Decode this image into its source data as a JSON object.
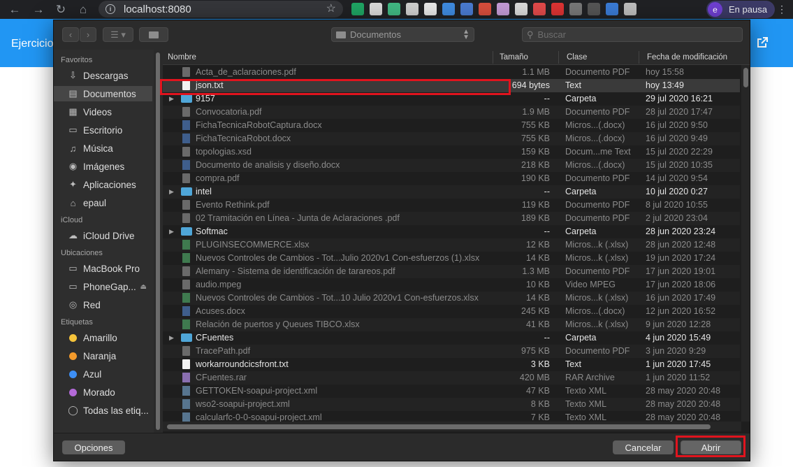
{
  "browser": {
    "url": "localhost:8080",
    "profile_label": "En pausa",
    "profile_initial": "e",
    "extensions": [
      "google-drive-icon",
      "qr-icon",
      "vue-icon",
      "video-icon",
      "download-icon",
      "feather-icon",
      "translate-icon",
      "person-icon",
      "chart-icon",
      "compass-icon",
      "pin-icon",
      "refresh-icon",
      "image-icon",
      "save-icon",
      "shield-icon",
      "puzzle-icon"
    ]
  },
  "page": {
    "title": "Ejercicio"
  },
  "dialog": {
    "location": "Documentos",
    "search_placeholder": "Buscar",
    "sidebar": {
      "sections": [
        {
          "heading": "Favoritos",
          "items": [
            {
              "label": "Descargas",
              "icon": "download-icon"
            },
            {
              "label": "Documentos",
              "icon": "document-icon",
              "selected": true
            },
            {
              "label": "Videos",
              "icon": "film-icon"
            },
            {
              "label": "Escritorio",
              "icon": "desktop-icon"
            },
            {
              "label": "Música",
              "icon": "music-icon"
            },
            {
              "label": "Imágenes",
              "icon": "camera-icon"
            },
            {
              "label": "Aplicaciones",
              "icon": "apps-icon"
            },
            {
              "label": "epaul",
              "icon": "home-icon"
            }
          ]
        },
        {
          "heading": "iCloud",
          "items": [
            {
              "label": "iCloud Drive",
              "icon": "cloud-icon"
            }
          ]
        },
        {
          "heading": "Ubicaciones",
          "items": [
            {
              "label": "MacBook Pro",
              "icon": "laptop-icon"
            },
            {
              "label": "PhoneGap...",
              "icon": "drive-icon"
            },
            {
              "label": "Red",
              "icon": "network-icon"
            }
          ]
        },
        {
          "heading": "Etiquetas",
          "items": [
            {
              "label": "Amarillo",
              "color": "#f5c33b"
            },
            {
              "label": "Naranja",
              "color": "#f39a2b"
            },
            {
              "label": "Azul",
              "color": "#3d8ff5"
            },
            {
              "label": "Morado",
              "color": "#b46ad8"
            },
            {
              "label": "Todas las etiq...",
              "icon": "all-tags-icon"
            }
          ]
        }
      ]
    },
    "columns": {
      "name": "Nombre",
      "size": "Tamaño",
      "kind": "Clase",
      "date": "Fecha de modificación"
    },
    "files": [
      {
        "name": "Acta_de_aclaraciones.pdf",
        "size": "1.1 MB",
        "kind": "Documento PDF",
        "date": "hoy 15:58",
        "type": "doc"
      },
      {
        "name": "json.txt",
        "size": "694 bytes",
        "kind": "Text",
        "date": "hoy 13:49",
        "type": "txt"
      },
      {
        "name": "9157",
        "size": "--",
        "kind": "Carpeta",
        "date": "29 jul 2020 16:21",
        "type": "folder"
      },
      {
        "name": "Convocatoria.pdf",
        "size": "1.9 MB",
        "kind": "Documento PDF",
        "date": "28 jul 2020 17:47",
        "type": "doc"
      },
      {
        "name": "FichaTecnicaRobotCaptura.docx",
        "size": "755 KB",
        "kind": "Micros...(.docx)",
        "date": "16 jul 2020 9:50",
        "type": "word"
      },
      {
        "name": "FichaTecnicaRobot.docx",
        "size": "755 KB",
        "kind": "Micros...(.docx)",
        "date": "16 jul 2020 9:49",
        "type": "word"
      },
      {
        "name": "topologias.xsd",
        "size": "159 KB",
        "kind": "Docum...me Text",
        "date": "15 jul 2020 22:29",
        "type": "doc"
      },
      {
        "name": "Documento de analisis y diseño.docx",
        "size": "218 KB",
        "kind": "Micros...(.docx)",
        "date": "15 jul 2020 10:35",
        "type": "word"
      },
      {
        "name": "compra.pdf",
        "size": "190 KB",
        "kind": "Documento PDF",
        "date": "14 jul 2020 9:54",
        "type": "doc"
      },
      {
        "name": "intel",
        "size": "--",
        "kind": "Carpeta",
        "date": "10 jul 2020 0:27",
        "type": "folder"
      },
      {
        "name": "Evento Rethink.pdf",
        "size": "119 KB",
        "kind": "Documento PDF",
        "date": "8 jul 2020 10:55",
        "type": "doc"
      },
      {
        "name": "02 Tramitación en Línea - Junta de Aclaraciones .pdf",
        "size": "189 KB",
        "kind": "Documento PDF",
        "date": "2 jul 2020 23:04",
        "type": "doc"
      },
      {
        "name": "Softmac",
        "size": "--",
        "kind": "Carpeta",
        "date": "28 jun 2020 23:24",
        "type": "folder"
      },
      {
        "name": "PLUGINSECOMMERCE.xlsx",
        "size": "12 KB",
        "kind": "Micros...k (.xlsx)",
        "date": "28 jun 2020 12:48",
        "type": "xls"
      },
      {
        "name": "Nuevos Controles de Cambios - Tot...Julio 2020v1 Con-esfuerzos (1).xlsx",
        "size": "14 KB",
        "kind": "Micros...k (.xlsx)",
        "date": "19 jun 2020 17:24",
        "type": "xls"
      },
      {
        "name": "Alemany - Sistema de identificación de tarareos.pdf",
        "size": "1.3 MB",
        "kind": "Documento PDF",
        "date": "17 jun 2020 19:01",
        "type": "doc"
      },
      {
        "name": "audio.mpeg",
        "size": "10 KB",
        "kind": "Video MPEG",
        "date": "17 jun 2020 18:06",
        "type": "doc"
      },
      {
        "name": "Nuevos Controles de Cambios - Tot...10 Julio 2020v1 Con-esfuerzos.xlsx",
        "size": "14 KB",
        "kind": "Micros...k (.xlsx)",
        "date": "16 jun 2020 17:49",
        "type": "xls"
      },
      {
        "name": "Acuses.docx",
        "size": "245 KB",
        "kind": "Micros...(.docx)",
        "date": "12 jun 2020 16:52",
        "type": "word"
      },
      {
        "name": "Relación de puertos y Queues TIBCO.xlsx",
        "size": "41 KB",
        "kind": "Micros...k (.xlsx)",
        "date": "9 jun 2020 12:28",
        "type": "xls"
      },
      {
        "name": "CFuentes",
        "size": "--",
        "kind": "Carpeta",
        "date": "4 jun 2020 15:49",
        "type": "folder"
      },
      {
        "name": "TracePath.pdf",
        "size": "975 KB",
        "kind": "Documento PDF",
        "date": "3 jun 2020 9:29",
        "type": "doc"
      },
      {
        "name": "workarroundcicsfront.txt",
        "size": "3 KB",
        "kind": "Text",
        "date": "1 jun 2020 17:45",
        "type": "txt"
      },
      {
        "name": "CFuentes.rar",
        "size": "420 MB",
        "kind": "RAR Archive",
        "date": "1 jun 2020 11:52",
        "type": "rar"
      },
      {
        "name": "GETTOKEN-soapui-project.xml",
        "size": "47 KB",
        "kind": "Texto XML",
        "date": "28 may 2020 20:48",
        "type": "xml"
      },
      {
        "name": "wso2-soapui-project.xml",
        "size": "8 KB",
        "kind": "Texto XML",
        "date": "28 may 2020 20:48",
        "type": "xml"
      },
      {
        "name": "calcularfc-0-0-soapui-project.xml",
        "size": "7 KB",
        "kind": "Texto XML",
        "date": "28 may 2020 20:48",
        "type": "xml"
      }
    ],
    "buttons": {
      "options": "Opciones",
      "cancel": "Cancelar",
      "open": "Abrir"
    }
  }
}
